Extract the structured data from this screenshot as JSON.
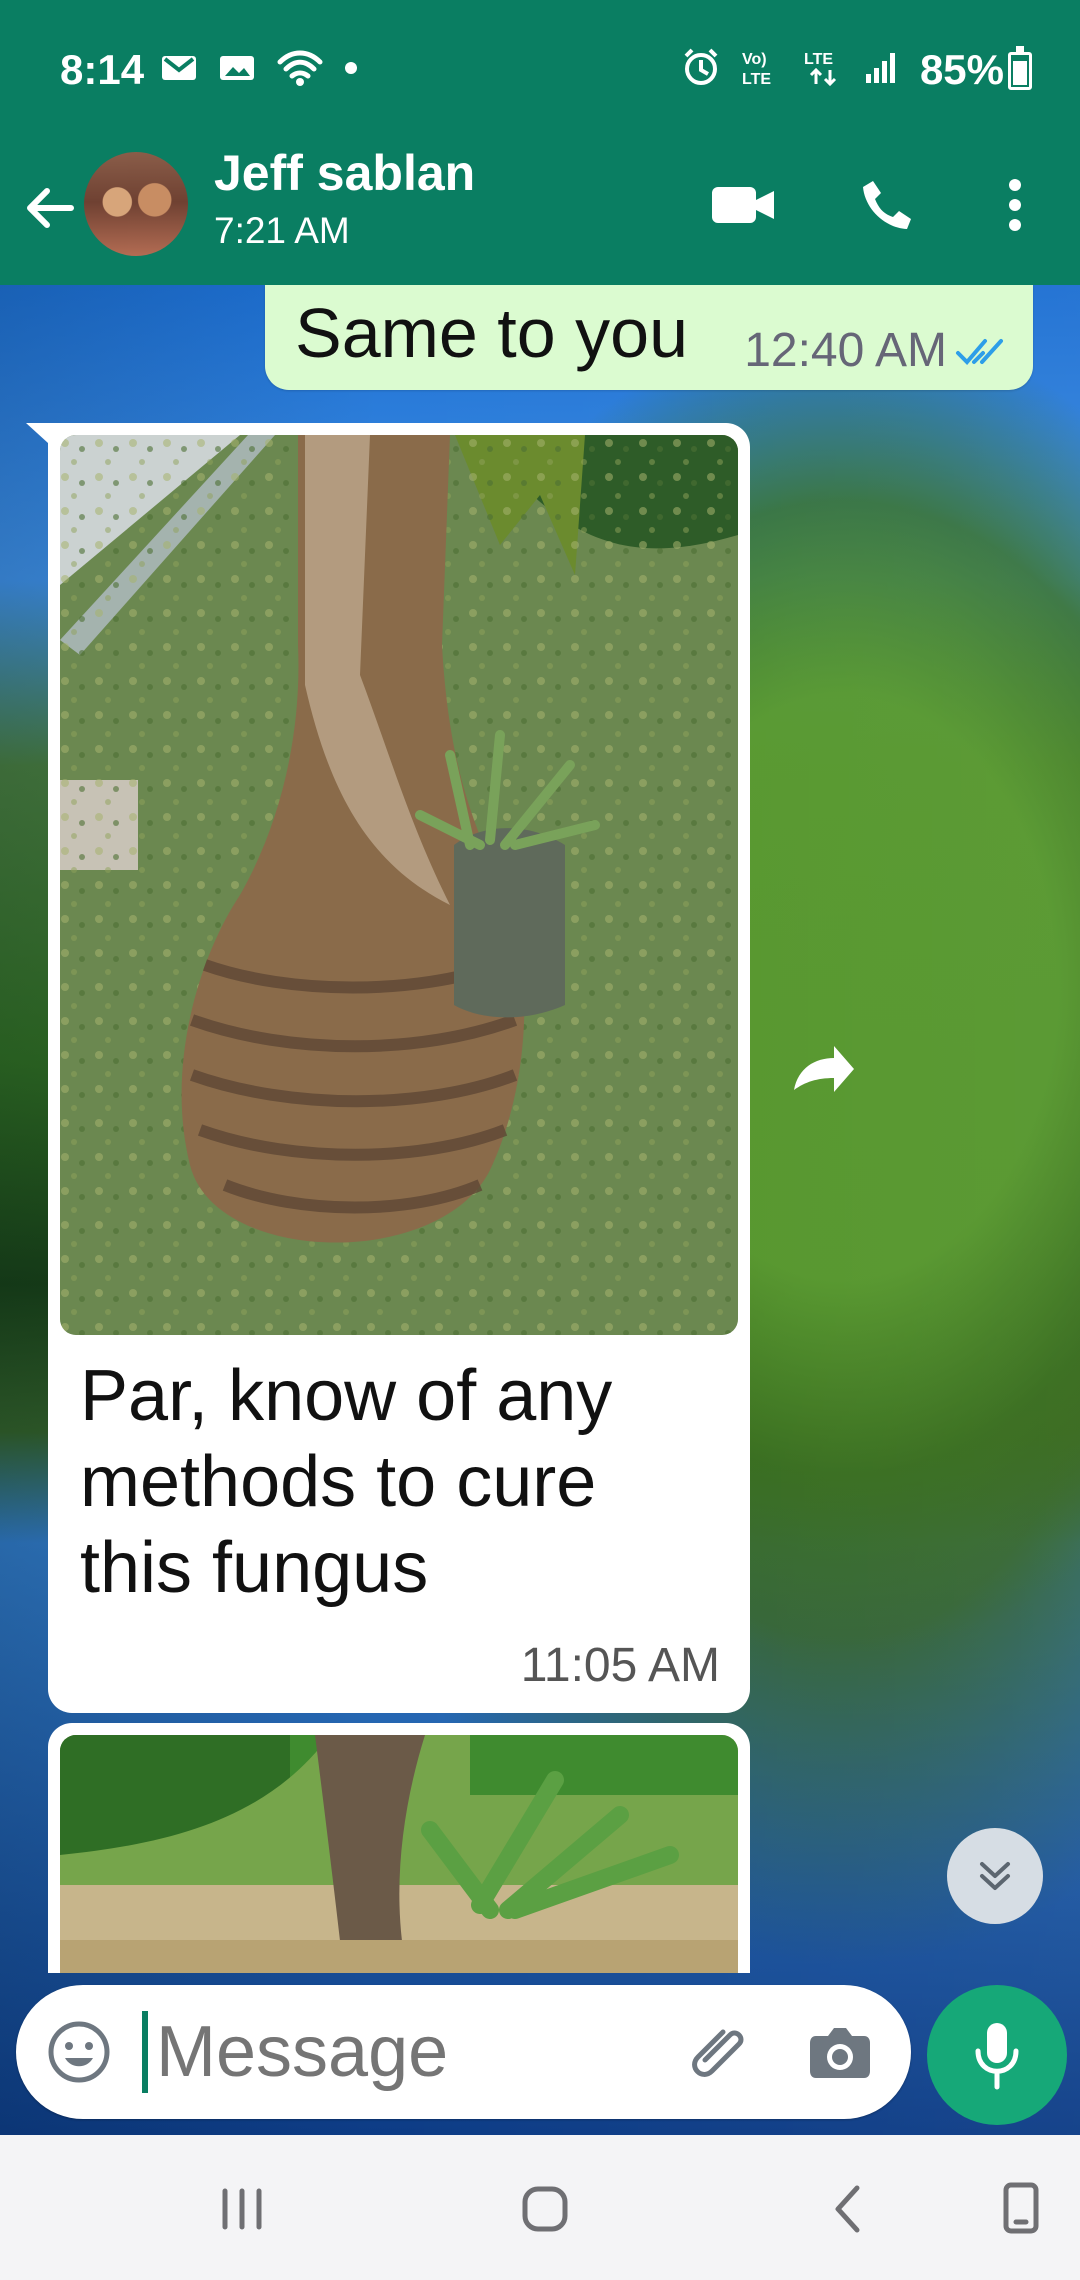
{
  "status_bar": {
    "time": "8:14",
    "battery": "85%",
    "battery_level": 0.85,
    "left_icons": [
      "mail-icon",
      "image-icon",
      "wifi-icon",
      "notification-dot-icon"
    ],
    "right_icons": [
      "alarm-icon",
      "volte-icon",
      "lte-icon",
      "signal-icon",
      "battery-icon"
    ]
  },
  "header": {
    "contact_name": "Jeff sablan",
    "last_seen": "7:21 AM",
    "back_icon": "back-arrow-icon",
    "actions": [
      "video-call-icon",
      "phone-call-icon",
      "more-options-icon"
    ]
  },
  "messages": {
    "sent_top": {
      "text": "Same to you",
      "time": "12:40 AM",
      "status": "read"
    },
    "incoming_1": {
      "text": "Par, know of any methods to cure this fungus",
      "time": "11:05 AM",
      "has_photo": true
    },
    "incoming_2": {
      "has_photo": true
    }
  },
  "composer": {
    "placeholder": "Message",
    "emoji_icon": "emoji-icon",
    "attach_icon": "paperclip-icon",
    "camera_icon": "camera-icon",
    "mic_icon": "microphone-icon"
  },
  "navigation": [
    "recent-apps-icon",
    "home-icon",
    "back-icon",
    "accessibility-icon"
  ],
  "colors": {
    "header": "#0a7e62",
    "sent_bubble": "#dbfbd0",
    "accent": "#16a878",
    "read_ticks": "#2d9ee8"
  }
}
